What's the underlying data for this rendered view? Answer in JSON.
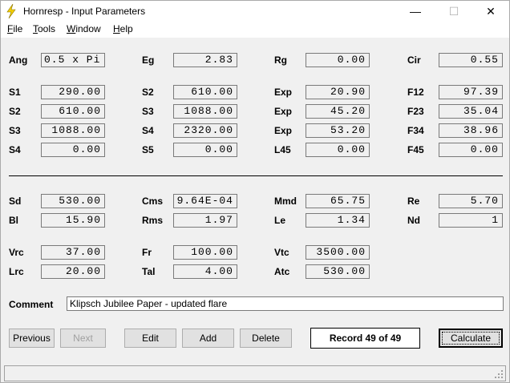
{
  "window": {
    "title": "Hornresp - Input Parameters",
    "controls": {
      "minimize": "—",
      "maximize": "☐",
      "close": "✕"
    }
  },
  "menu": [
    {
      "label": "File",
      "mnemonic": "F",
      "rest": "ile"
    },
    {
      "label": "Tools",
      "mnemonic": "T",
      "rest": "ools"
    },
    {
      "label": "Window",
      "mnemonic": "W",
      "rest": "indow"
    },
    {
      "label": "Help",
      "mnemonic": "H",
      "rest": "elp"
    }
  ],
  "fields": {
    "ang": {
      "label": "Ang",
      "value": "0.5 x Pi"
    },
    "eg": {
      "label": "Eg",
      "value": "2.83"
    },
    "rg": {
      "label": "Rg",
      "value": "0.00"
    },
    "cir": {
      "label": "Cir",
      "value": "0.55"
    },
    "s1": {
      "label": "S1",
      "value": "290.00"
    },
    "s2a": {
      "label": "S2",
      "value": "610.00"
    },
    "exp1": {
      "label": "Exp",
      "value": "20.90"
    },
    "f12": {
      "label": "F12",
      "value": "97.39"
    },
    "s2b": {
      "label": "S2",
      "value": "610.00"
    },
    "s3a": {
      "label": "S3",
      "value": "1088.00"
    },
    "exp2": {
      "label": "Exp",
      "value": "45.20"
    },
    "f23": {
      "label": "F23",
      "value": "35.04"
    },
    "s3b": {
      "label": "S3",
      "value": "1088.00"
    },
    "s4a": {
      "label": "S4",
      "value": "2320.00"
    },
    "exp3": {
      "label": "Exp",
      "value": "53.20"
    },
    "f34": {
      "label": "F34",
      "value": "38.96"
    },
    "s4b": {
      "label": "S4",
      "value": "0.00"
    },
    "s5": {
      "label": "S5",
      "value": "0.00"
    },
    "l45": {
      "label": "L45",
      "value": "0.00"
    },
    "f45": {
      "label": "F45",
      "value": "0.00"
    },
    "sd": {
      "label": "Sd",
      "value": "530.00"
    },
    "cms": {
      "label": "Cms",
      "value": "9.64E-04"
    },
    "mmd": {
      "label": "Mmd",
      "value": "65.75"
    },
    "re": {
      "label": "Re",
      "value": "5.70"
    },
    "bl": {
      "label": "Bl",
      "value": "15.90"
    },
    "rms": {
      "label": "Rms",
      "value": "1.97"
    },
    "le": {
      "label": "Le",
      "value": "1.34"
    },
    "nd": {
      "label": "Nd",
      "value": "1"
    },
    "vrc": {
      "label": "Vrc",
      "value": "37.00"
    },
    "fr": {
      "label": "Fr",
      "value": "100.00"
    },
    "vtc": {
      "label": "Vtc",
      "value": "3500.00"
    },
    "lrc": {
      "label": "Lrc",
      "value": "20.00"
    },
    "tal": {
      "label": "Tal",
      "value": "4.00"
    },
    "atc": {
      "label": "Atc",
      "value": "530.00"
    }
  },
  "comment": {
    "label": "Comment",
    "value": "Klipsch Jubilee Paper - updated flare"
  },
  "buttons": {
    "previous": "Previous",
    "next": "Next",
    "edit": "Edit",
    "add": "Add",
    "delete": "Delete",
    "calculate": "Calculate"
  },
  "record": "Record 49 of 49",
  "colors": {
    "window_bg": "#f0f0f0",
    "icon_yellow": "#f5d000"
  }
}
